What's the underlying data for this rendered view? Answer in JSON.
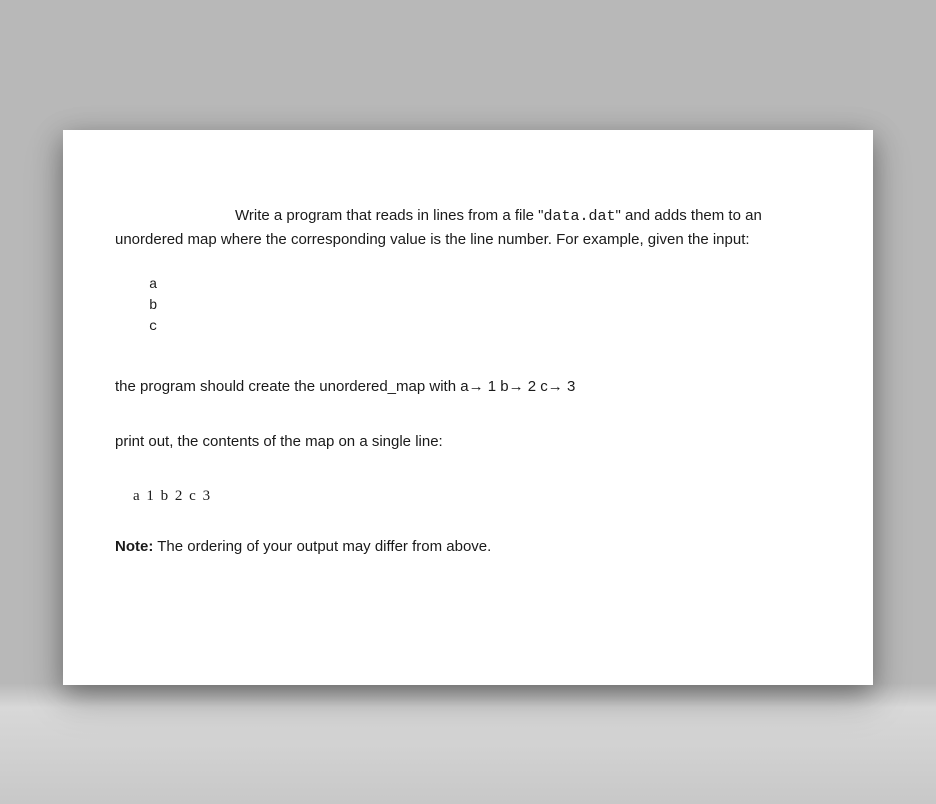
{
  "intro": {
    "part1": "Write a program that reads in lines from a file \"",
    "filename": "data.dat",
    "part2": "\" and adds them to an unordered map where the corresponding value is the line number. For example, given the input:"
  },
  "codeBlock": "a\nb\nc",
  "mapSentence": {
    "prefix": "the program should create the unordered_map with ",
    "m1k": "a",
    "arrow": "→",
    "m1v": " 1  ",
    "m2k": "b",
    "m2v": " 2 ",
    "m3k": "c",
    "m3v": " 3"
  },
  "printInstruction": "print out, the contents of the map on a single line:",
  "outputExample": "a 1 b 2 c 3",
  "note": {
    "label": "Note:",
    "text": " The ordering of your output may differ from above."
  }
}
